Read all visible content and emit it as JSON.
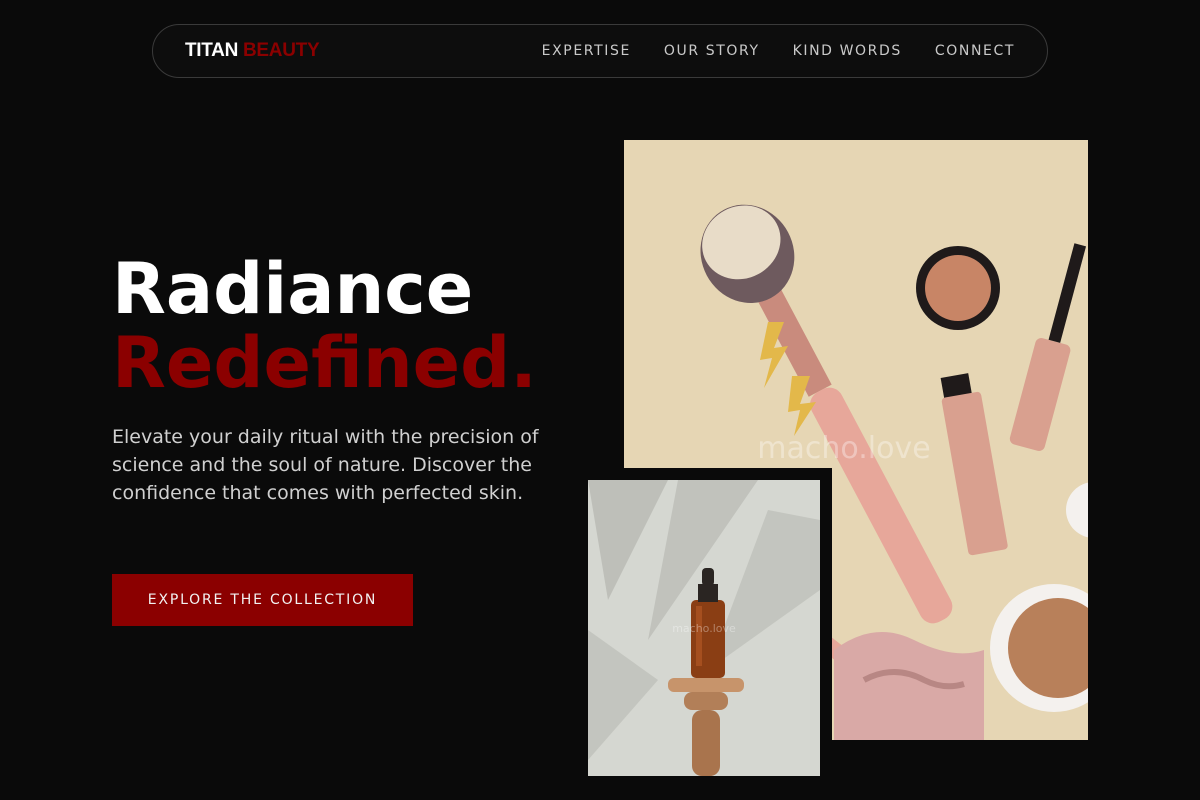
{
  "brand": {
    "name_white": "TITAN",
    "name_red": "BEAUTY"
  },
  "nav": {
    "items": [
      {
        "label": "EXPERTISE"
      },
      {
        "label": "OUR STORY"
      },
      {
        "label": "KIND WORDS"
      },
      {
        "label": "CONNECT"
      }
    ]
  },
  "hero": {
    "headline_line1": "Radiance",
    "headline_line2": "Redefined.",
    "description": "Elevate your daily ritual with the precision of science and the soul of nature. Discover the confidence that comes with perfected skin.",
    "cta_label": "EXPLORE THE COLLECTION"
  },
  "images": {
    "main_watermark": "macho.love",
    "small_watermark": "macho.love"
  },
  "colors": {
    "background": "#0a0a0a",
    "accent": "#8b0000",
    "text": "#ffffff"
  }
}
